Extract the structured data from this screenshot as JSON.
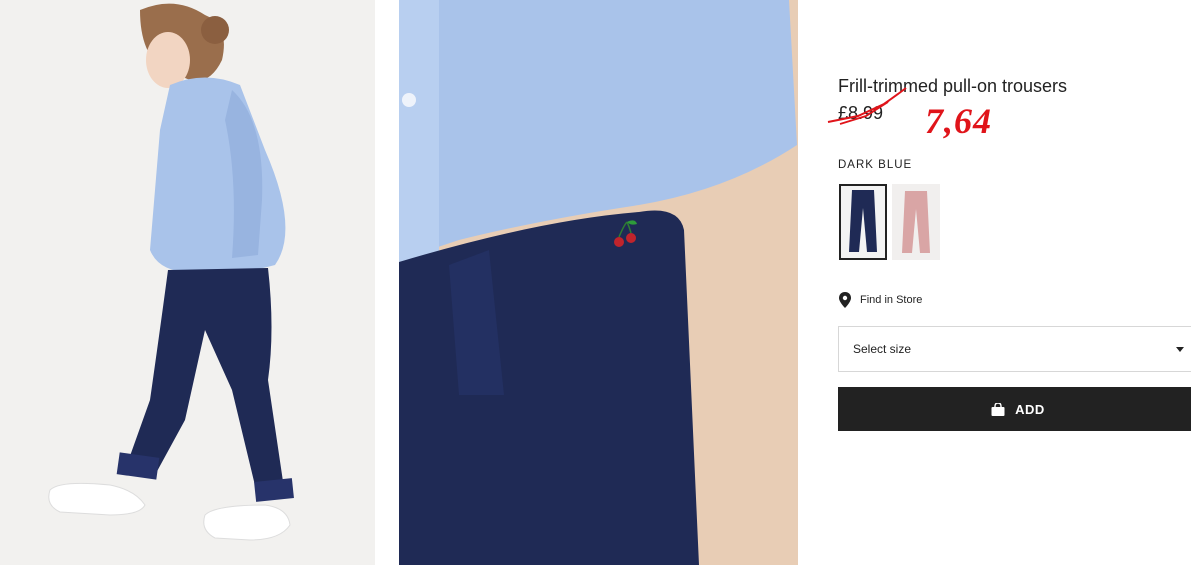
{
  "product": {
    "title": "Frill-trimmed pull-on trousers",
    "old_price": "£8.99",
    "new_price": "7,64",
    "color_label": "DARK BLUE"
  },
  "swatches": [
    {
      "name": "dark-blue",
      "color": "#1f2a55",
      "selected": true
    },
    {
      "name": "pink",
      "color": "#d9a5a5",
      "selected": false
    }
  ],
  "find_in_store": {
    "label": "Find in Store",
    "icon": "location-pin-icon"
  },
  "size_select": {
    "label": "Select size",
    "icon": "caret-down-icon"
  },
  "add_button": {
    "label": "ADD",
    "icon": "shopping-bag-icon"
  },
  "colors": {
    "accent": "#e0141a",
    "button_bg": "#222222",
    "navy": "#1f2a55",
    "shirt": "#a9c3ea"
  }
}
